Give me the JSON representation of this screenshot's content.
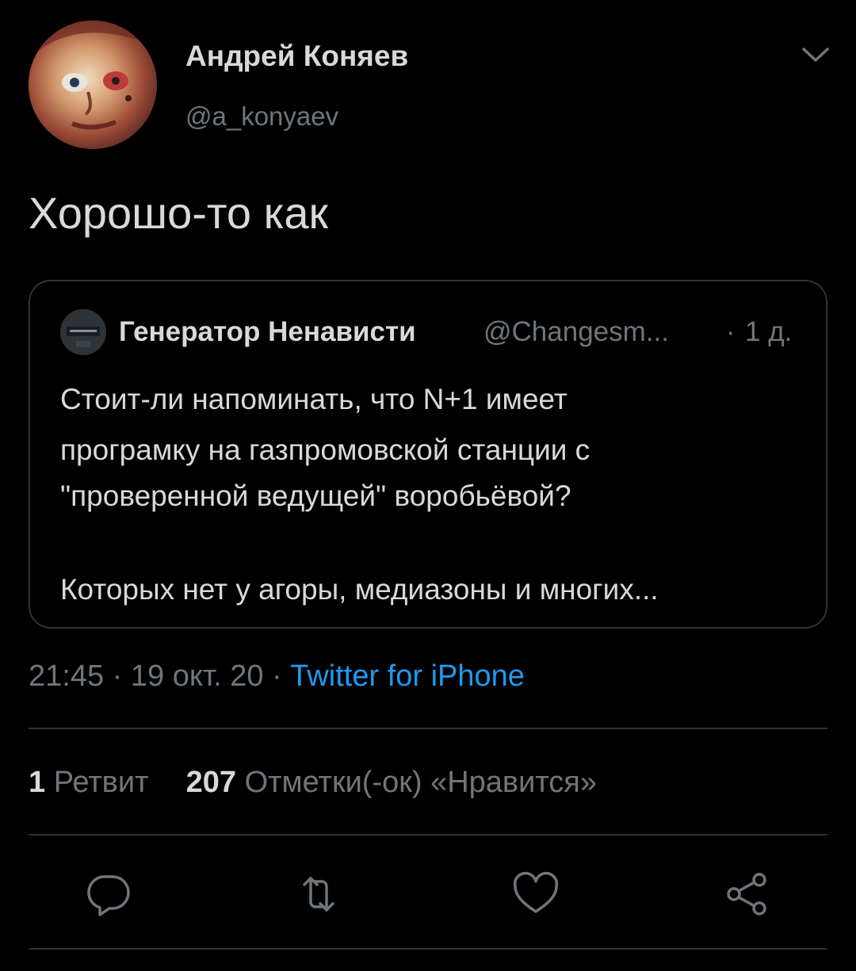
{
  "header": {
    "author_name": "Андрей Коняев",
    "author_handle": "@a_konyaev"
  },
  "tweet": {
    "text": "Хорошо-то как"
  },
  "quote": {
    "author_name": "Генератор Ненависти",
    "author_handle": "@Changesm...",
    "separator": "·",
    "time_ago": "1 д.",
    "lines": [
      "Стоит-ли напоминать, что N+1 имеет",
      "програмку на газпромовской станции с",
      "\"проверенной ведущей\" воробьёвой?",
      "Которых нет у агоры, медиазоны и многих..."
    ]
  },
  "meta": {
    "time": "21:45",
    "date": "19 окт. 20",
    "separator": "·",
    "source": "Twitter for iPhone"
  },
  "stats": {
    "retweets_count": "1",
    "retweets_label": "Ретвит",
    "likes_count": "207",
    "likes_label": "Отметки(-ок) «Нравится»"
  },
  "actions": {
    "icons": [
      "reply-icon",
      "retweet-icon",
      "like-icon",
      "share-icon"
    ]
  },
  "colors": {
    "background": "#000000",
    "text": "#d9d9d9",
    "secondary": "#6e767d",
    "link": "#1d9bf0",
    "border": "#2f3336"
  }
}
